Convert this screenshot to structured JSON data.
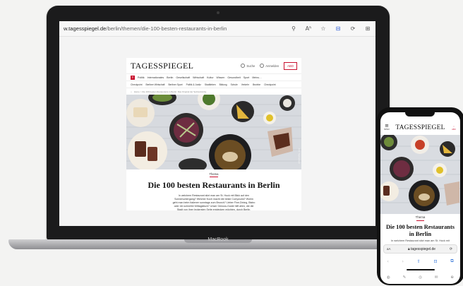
{
  "browser": {
    "url_host": "w.tagesspiegel.de",
    "url_path": "/berlin/themen/die-100-besten-restaurants-in-berlin",
    "icons": [
      "search-icon",
      "read-aloud-icon",
      "favorite-icon",
      "extension-icon",
      "refresh-icon",
      "split-view-icon"
    ],
    "icon_glyphs": [
      "⚲",
      "Aʱ",
      "☆",
      "⊟",
      "⟳",
      "⊞"
    ]
  },
  "site": {
    "logo": "TAGESSPIEGEL",
    "search_label": "Suche",
    "account_label": "Anmelden",
    "abo_label": "ABO",
    "nav_badge": "T",
    "nav_items": [
      "Politik",
      "Internationales",
      "Berlin",
      "Gesellschaft",
      "Wirtschaft",
      "Kultur",
      "Wissen",
      "Gesundheit",
      "Sport",
      "Meinu…"
    ],
    "subnav_items": [
      "Checkpoint",
      "Berliner Wirtschaft",
      "Berliner Sport",
      "Politik & Justiz",
      "Stadtleben",
      "Bildung",
      "Schule",
      "Verkehr",
      "Bezirke",
      "Checkpoint"
    ],
    "breadcrumb": "Home > Die 100 besten Restaurants in Berlin: Das Original der Spitzenköche",
    "photo_credit": "Foto: Tagesspiegel"
  },
  "article": {
    "tag": "Thema",
    "headline": "Die 100 besten Restaurants in Berlin",
    "lede": "In welchem Restaurant sitzt man am St. Hock mit Blick auf den Sonnenuntergang? Welcher Koch macht die beste Currywurst? Wohin geht man beim Italiener sonntags zum Brunch? Lieber Fine-Dining, Bistro oder ein schneller Mittagstisch? Unser Genuss-Guide hilft allen, die die Stadt von ihrer leckersten Seite entdecken möchten, durch Berlin."
  },
  "laptop": {
    "brand": "MacBook"
  },
  "phone": {
    "menu_label": "MENÜ",
    "logo": "TAGESSPIEGEL",
    "abo_label": "ABO",
    "tag": "Thema",
    "headline": "Die 100 besten Restaurants in Berlin",
    "lede": "In welchem Restaurant sitzt man am St. Hock mit",
    "url_aa": "aA",
    "url": "tagesspiegel.de",
    "nav_glyphs": [
      "‹",
      "›",
      "⇧",
      "⊡",
      "⧉"
    ],
    "share_glyphs": [
      "◍",
      "✎",
      "◎",
      "✉",
      "⊕"
    ]
  },
  "colors": {
    "brand_red": "#c8102e",
    "link_blue": "#2a6fd6"
  }
}
